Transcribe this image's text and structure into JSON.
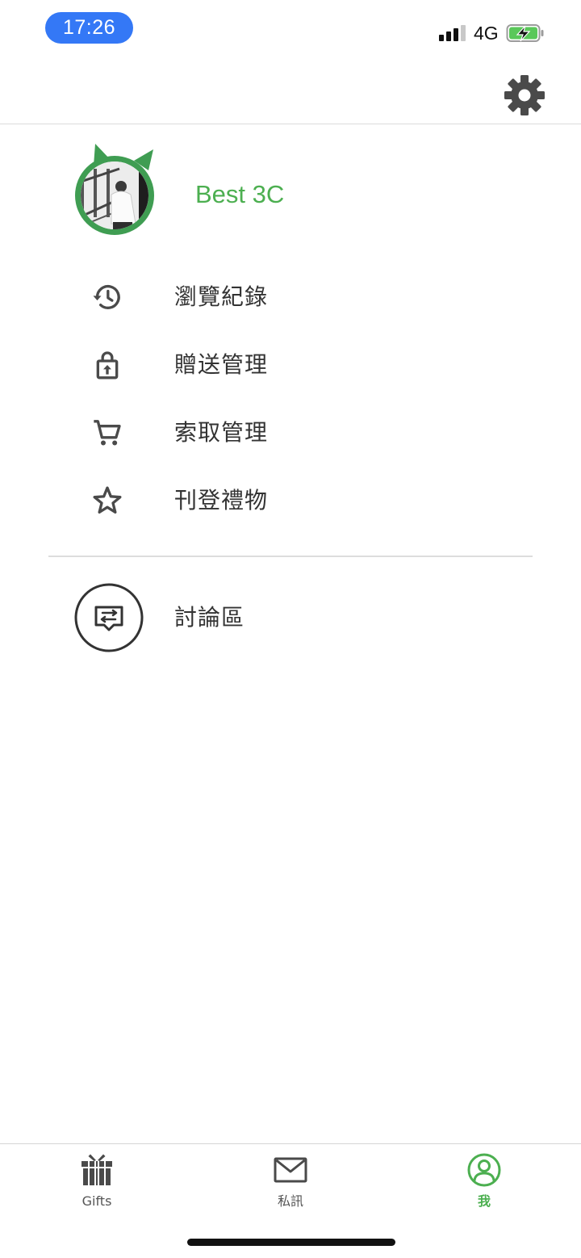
{
  "status_bar": {
    "time": "17:26",
    "network": "4G",
    "battery_charging": true
  },
  "header": {
    "settings_icon": "gear-icon"
  },
  "profile": {
    "username": "Best 3C",
    "avatar_icon": "avatar-photo"
  },
  "menu": {
    "items": [
      {
        "label": "瀏覽紀錄",
        "icon": "history-icon"
      },
      {
        "label": "贈送管理",
        "icon": "lock-upload-icon"
      },
      {
        "label": "索取管理",
        "icon": "cart-icon"
      },
      {
        "label": "刊登禮物",
        "icon": "star-icon"
      }
    ],
    "forum": {
      "label": "討論區",
      "icon": "chat-swap-icon"
    }
  },
  "bottom_nav": {
    "items": [
      {
        "label": "Gifts",
        "icon": "gift-icon",
        "active": false
      },
      {
        "label": "私訊",
        "icon": "mail-icon",
        "active": false
      },
      {
        "label": "我",
        "icon": "person-icon",
        "active": true
      }
    ]
  },
  "colors": {
    "accent": "#4caf50",
    "time_pill": "#3478f6",
    "text": "#333333",
    "icon": "#4a4a4a",
    "divider": "#dddddd"
  }
}
